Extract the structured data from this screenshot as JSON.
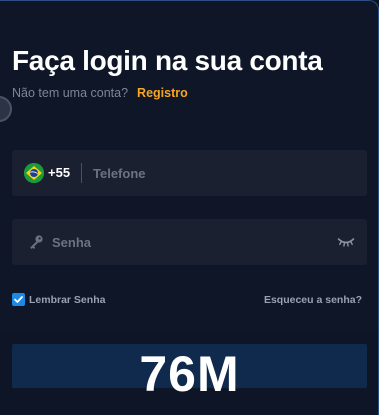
{
  "header": {
    "title": "Faça login na sua conta",
    "subtitle": "Não tem uma conta?",
    "register_link": "Registro"
  },
  "phone": {
    "flag_icon": "brazil-flag-icon",
    "country_code": "+55",
    "placeholder": "Telefone",
    "value": ""
  },
  "password": {
    "icon": "key-icon",
    "placeholder": "Senha",
    "value": "",
    "toggle_icon": "eye-closed-icon"
  },
  "remember": {
    "label": "Lembrar Senha",
    "checked": true
  },
  "forgot_link": "Esqueceu a senha?",
  "overlay_text": "76M",
  "colors": {
    "background": "#0e1628",
    "field_background": "#1a2030",
    "accent": "#f5a623",
    "checkbox": "#1e88e5",
    "button": "#0f2a4d",
    "border": "#2d4d86"
  }
}
